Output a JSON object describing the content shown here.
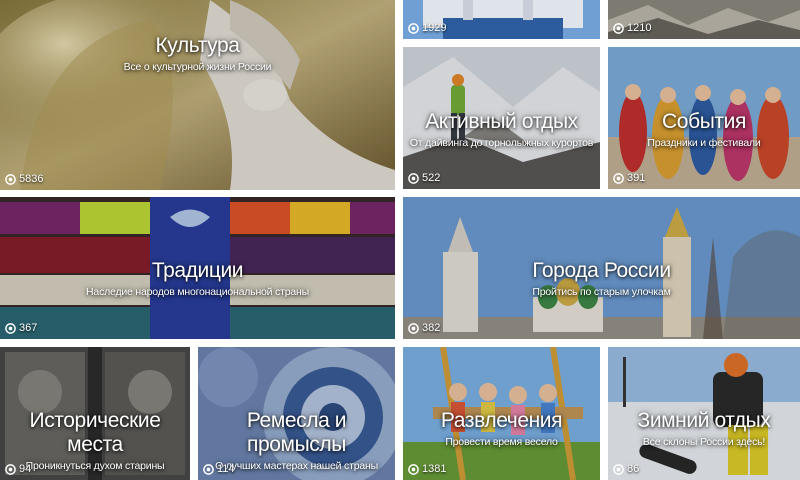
{
  "tiles": [
    {
      "id": "culture",
      "title": "Культура",
      "subtitle": "Все о культурной жизни России",
      "count": "5836",
      "icon": "eye-icon"
    },
    {
      "id": "top-church",
      "title": "",
      "subtitle": "",
      "count": "1929",
      "icon": "eye-icon"
    },
    {
      "id": "top-rocks",
      "title": "",
      "subtitle": "",
      "count": "1210",
      "icon": "eye-icon"
    },
    {
      "id": "active",
      "title": "Активный отдых",
      "subtitle": "От дайвинга до горнолыжных курортов",
      "count": "522",
      "icon": "eye-icon"
    },
    {
      "id": "events",
      "title": "События",
      "subtitle": "Праздники и фестивали",
      "count": "391",
      "icon": "eye-icon"
    },
    {
      "id": "traditions",
      "title": "Традиции",
      "subtitle": "Наследие народов многонациональной страны",
      "count": "367",
      "icon": "eye-icon"
    },
    {
      "id": "cities",
      "title": "Города России",
      "subtitle": "Пройтись по старым улочкам",
      "count": "382",
      "icon": "eye-icon"
    },
    {
      "id": "historic",
      "title": "Исторические места",
      "subtitle": "Проникнуться духом старины",
      "count": "94",
      "icon": "eye-icon"
    },
    {
      "id": "crafts",
      "title": "Ремесла и промыслы",
      "subtitle": "О лучших мастерах нашей страны",
      "count": "114",
      "icon": "eye-icon"
    },
    {
      "id": "fun",
      "title": "Развлечения",
      "subtitle": "Провести время весело",
      "count": "1381",
      "icon": "eye-icon"
    },
    {
      "id": "winter",
      "title": "Зимний отдых",
      "subtitle": "Все склоны России здесь!",
      "count": "86",
      "icon": "eye-icon"
    }
  ]
}
